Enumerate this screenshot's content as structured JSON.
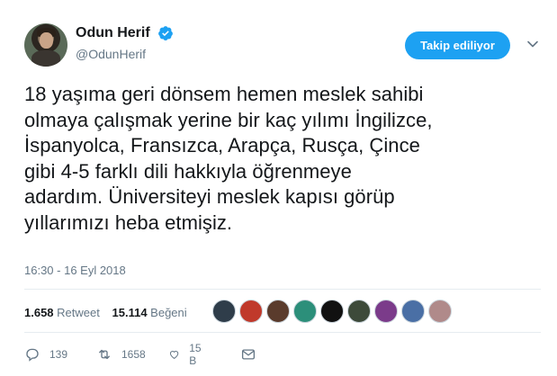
{
  "user": {
    "display_name": "Odun Herif",
    "handle": "@OdunHerif"
  },
  "follow_label": "Takip ediliyor",
  "tweet_lines": [
    "18 yaşıma geri dönsem hemen meslek sahibi",
    "olmaya çalışmak yerine bir kaç yılımı İngilizce,",
    "İspanyolca, Fransızca, Arapça, Rusça, Çince",
    "gibi 4-5 farklı dili hakkıyla öğrenmeye",
    "adardım. Üniversiteyi meslek kapısı görüp",
    "yıllarımızı heba etmişiz."
  ],
  "timestamp": "16:30 - 16 Eyl 2018",
  "stats": {
    "retweet_count": "1.658",
    "retweet_label": "Retweet",
    "like_count": "15.114",
    "like_label": "Beğeni"
  },
  "actions": {
    "reply_count": "139",
    "retweet_count": "1658",
    "like_count": "15 B"
  },
  "colors": {
    "accent": "#1da1f2",
    "muted": "#657786",
    "text": "#14171a"
  },
  "icons": [
    "verified-icon",
    "chevron-down-icon",
    "reply-icon",
    "retweet-icon",
    "like-icon",
    "direct-message-icon"
  ]
}
